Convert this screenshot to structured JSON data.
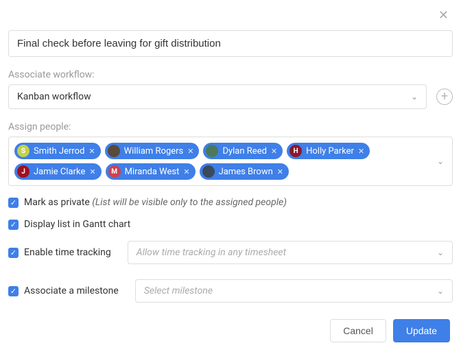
{
  "title_value": "Final check before leaving for gift distribution",
  "labels": {
    "workflow": "Associate workflow:",
    "assign": "Assign people:"
  },
  "workflow": {
    "selected": "Kanban workflow"
  },
  "people": [
    {
      "name": "Smith Jerrod",
      "avatar_bg": "#c3d24a",
      "avatar_letter": "S"
    },
    {
      "name": "William Rogers",
      "avatar_bg": "#5a4a3a",
      "avatar_letter": ""
    },
    {
      "name": "Dylan Reed",
      "avatar_bg": "#4a7a5a",
      "avatar_letter": ""
    },
    {
      "name": "Holly Parker",
      "avatar_bg": "#8a1a2a",
      "avatar_letter": "H"
    },
    {
      "name": "Jamie Clarke",
      "avatar_bg": "#a01020",
      "avatar_letter": "J"
    },
    {
      "name": "Miranda West",
      "avatar_bg": "#d04050",
      "avatar_letter": "M"
    },
    {
      "name": "James Brown",
      "avatar_bg": "#3a4a5a",
      "avatar_letter": ""
    }
  ],
  "options": {
    "private_label": "Mark as private ",
    "private_note": "(List will be visible only to the assigned people)",
    "gantt_label": "Display list in Gantt chart",
    "time_label": "Enable time tracking",
    "time_placeholder": "Allow time tracking in any timesheet",
    "milestone_label": "Associate a milestone",
    "milestone_placeholder": "Select milestone"
  },
  "buttons": {
    "cancel": "Cancel",
    "update": "Update"
  }
}
